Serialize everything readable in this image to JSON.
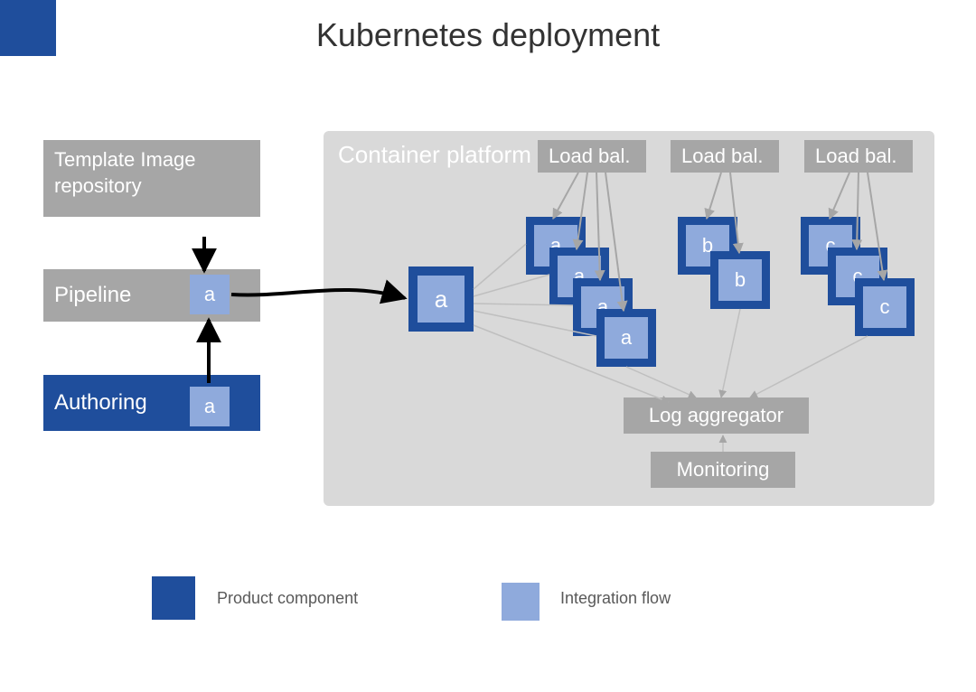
{
  "title": "Kubernetes deployment",
  "left": {
    "template_repo": "Template Image repository",
    "pipeline": "Pipeline",
    "authoring": "Authoring",
    "flow_label": "a"
  },
  "platform": {
    "heading": "Container platform",
    "load_balancer": "Load bal.",
    "log_aggregator": "Log aggregator",
    "monitoring": "Monitoring",
    "pod_a": "a",
    "pod_b": "b",
    "pod_c": "c"
  },
  "legend": {
    "product_component": "Product component",
    "integration_flow": "Integration flow"
  },
  "colors": {
    "product": "#1f4e9c",
    "flow": "#8faadc",
    "gray": "#a6a6a6",
    "light_gray": "#d9d9d9"
  }
}
